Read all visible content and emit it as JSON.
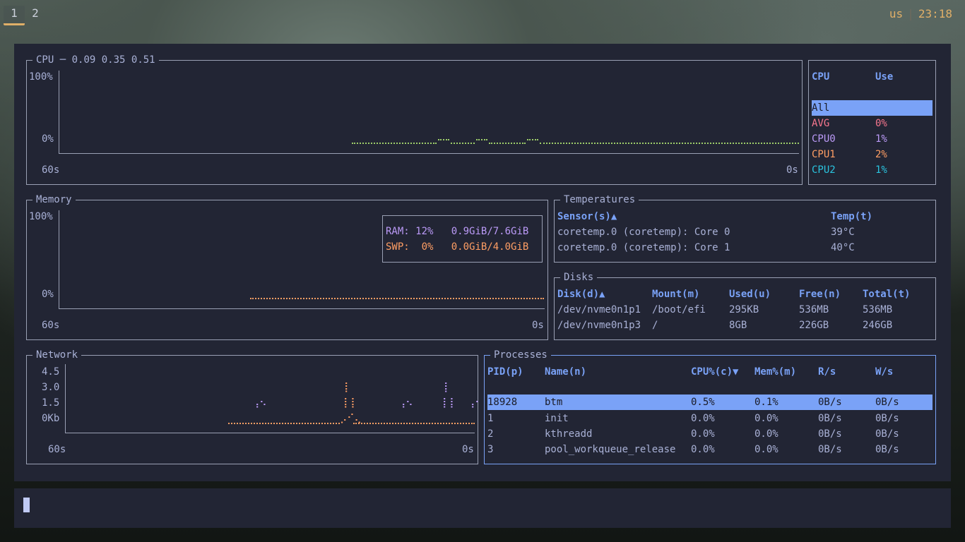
{
  "colors": {
    "accent": "#7aa2f7",
    "green": "#9ece6a",
    "orange": "#ff9e64",
    "purple": "#bb9af7",
    "red": "#f7768e",
    "cyan": "#2ac3de",
    "yellow": "#e0af68"
  },
  "topbar": {
    "workspaces": [
      "1",
      "2"
    ],
    "keyboard_layout": "us",
    "clock": "23:18"
  },
  "cpu": {
    "title": "CPU",
    "loadavg": "0.09 0.35 0.51",
    "y_top": "100%",
    "y_bottom": "0%",
    "x_left": "60s",
    "x_right": "0s",
    "legend_header": {
      "cpu": "CPU",
      "use": "Use"
    },
    "legend_rows": [
      {
        "name": "All",
        "use": ""
      },
      {
        "name": "AVG",
        "use": "0%"
      },
      {
        "name": "CPU0",
        "use": "1%"
      },
      {
        "name": "CPU1",
        "use": "2%"
      },
      {
        "name": "CPU2",
        "use": "1%"
      }
    ]
  },
  "memory": {
    "title": "Memory",
    "y_top": "100%",
    "y_bottom": "0%",
    "x_left": "60s",
    "x_right": "0s",
    "ram": {
      "label": "RAM:",
      "pct": "12%",
      "amount": "0.9GiB/7.6GiB"
    },
    "swp": {
      "label": "SWP:",
      "pct": "0%",
      "amount": "0.0GiB/4.0GiB"
    }
  },
  "temperatures": {
    "title": "Temperatures",
    "headers": {
      "sensor": "Sensor(s)▲",
      "temp": "Temp(t)"
    },
    "rows": [
      {
        "sensor": "coretemp.0 (coretemp): Core 0",
        "temp": "39°C"
      },
      {
        "sensor": "coretemp.0 (coretemp): Core 1",
        "temp": "40°C"
      }
    ]
  },
  "disks": {
    "title": "Disks",
    "headers": {
      "disk": "Disk(d)▲",
      "mount": "Mount(m)",
      "used": "Used(u)",
      "free": "Free(n)",
      "total": "Total(t)"
    },
    "rows": [
      {
        "disk": "/dev/nvme0n1p1",
        "mount": "/boot/efi",
        "used": "295KB",
        "free": "536MB",
        "total": "536MB"
      },
      {
        "disk": "/dev/nvme0n1p3",
        "mount": "/",
        "used": "8GB",
        "free": "226GB",
        "total": "246GB"
      }
    ]
  },
  "network": {
    "title": "Network",
    "y_ticks": [
      "4.5",
      "3.0",
      "1.5",
      "0Kb"
    ],
    "x_left": "60s",
    "x_right": "0s"
  },
  "processes": {
    "title": "Processes",
    "headers": {
      "pid": "PID(p)",
      "name": "Name(n)",
      "cpu": "CPU%(c)▼",
      "mem": "Mem%(m)",
      "rs": "R/s",
      "ws": "W/s"
    },
    "rows": [
      {
        "pid": "18928",
        "name": "btm",
        "cpu": "0.5%",
        "mem": "0.1%",
        "rs": "0B/s",
        "ws": "0B/s"
      },
      {
        "pid": "1",
        "name": "init",
        "cpu": "0.0%",
        "mem": "0.0%",
        "rs": "0B/s",
        "ws": "0B/s"
      },
      {
        "pid": "2",
        "name": "kthreadd",
        "cpu": "0.0%",
        "mem": "0.0%",
        "rs": "0B/s",
        "ws": "0B/s"
      },
      {
        "pid": "3",
        "name": "pool_workqueue_release",
        "cpu": "0.0%",
        "mem": "0.0%",
        "rs": "0B/s",
        "ws": "0B/s"
      }
    ]
  }
}
